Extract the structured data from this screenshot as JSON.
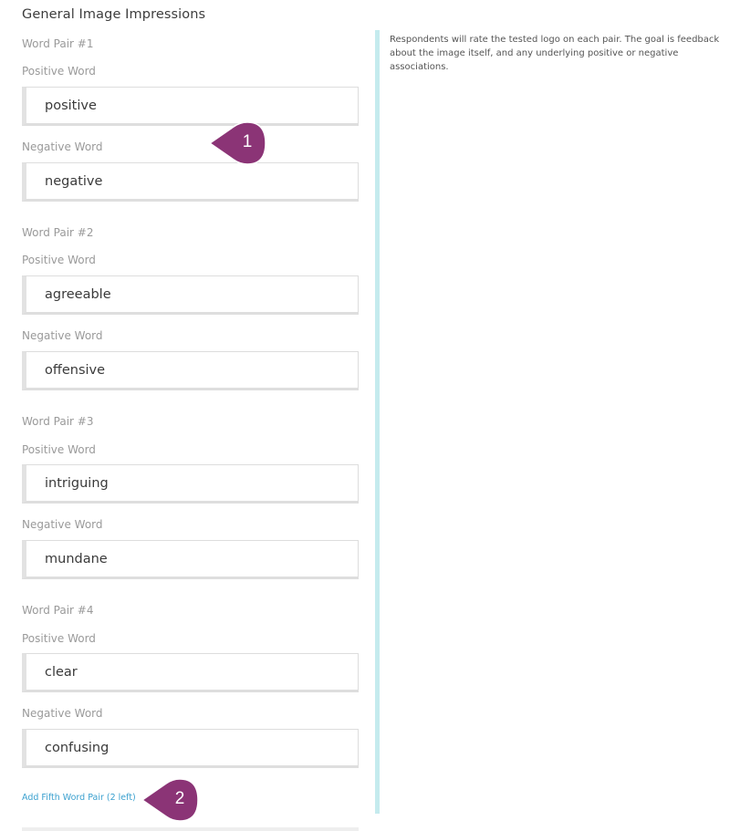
{
  "section": {
    "title": "General Image Impressions"
  },
  "pairs": [
    {
      "label": "Word Pair #1",
      "positive_label": "Positive Word",
      "positive_value": "positive",
      "negative_label": "Negative Word",
      "negative_value": "negative"
    },
    {
      "label": "Word Pair #2",
      "positive_label": "Positive Word",
      "positive_value": "agreeable",
      "negative_label": "Negative Word",
      "negative_value": "offensive"
    },
    {
      "label": "Word Pair #3",
      "positive_label": "Positive Word",
      "positive_value": "intriguing",
      "negative_label": "Negative Word",
      "negative_value": "mundane"
    },
    {
      "label": "Word Pair #4",
      "positive_label": "Positive Word",
      "positive_value": "clear",
      "negative_label": "Negative Word",
      "negative_value": "confusing"
    }
  ],
  "help": {
    "text": "Respondents will rate the tested logo on each pair. The goal is feedback about the image itself, and any underlying positive or negative associations."
  },
  "add_link": {
    "label": "Add Fifth Word Pair (2 left)"
  },
  "callouts": [
    {
      "number": "1"
    },
    {
      "number": "2"
    }
  ],
  "colors": {
    "callout": "#8b3476",
    "divider": "#c5ebee",
    "link": "#3aa0cf"
  }
}
